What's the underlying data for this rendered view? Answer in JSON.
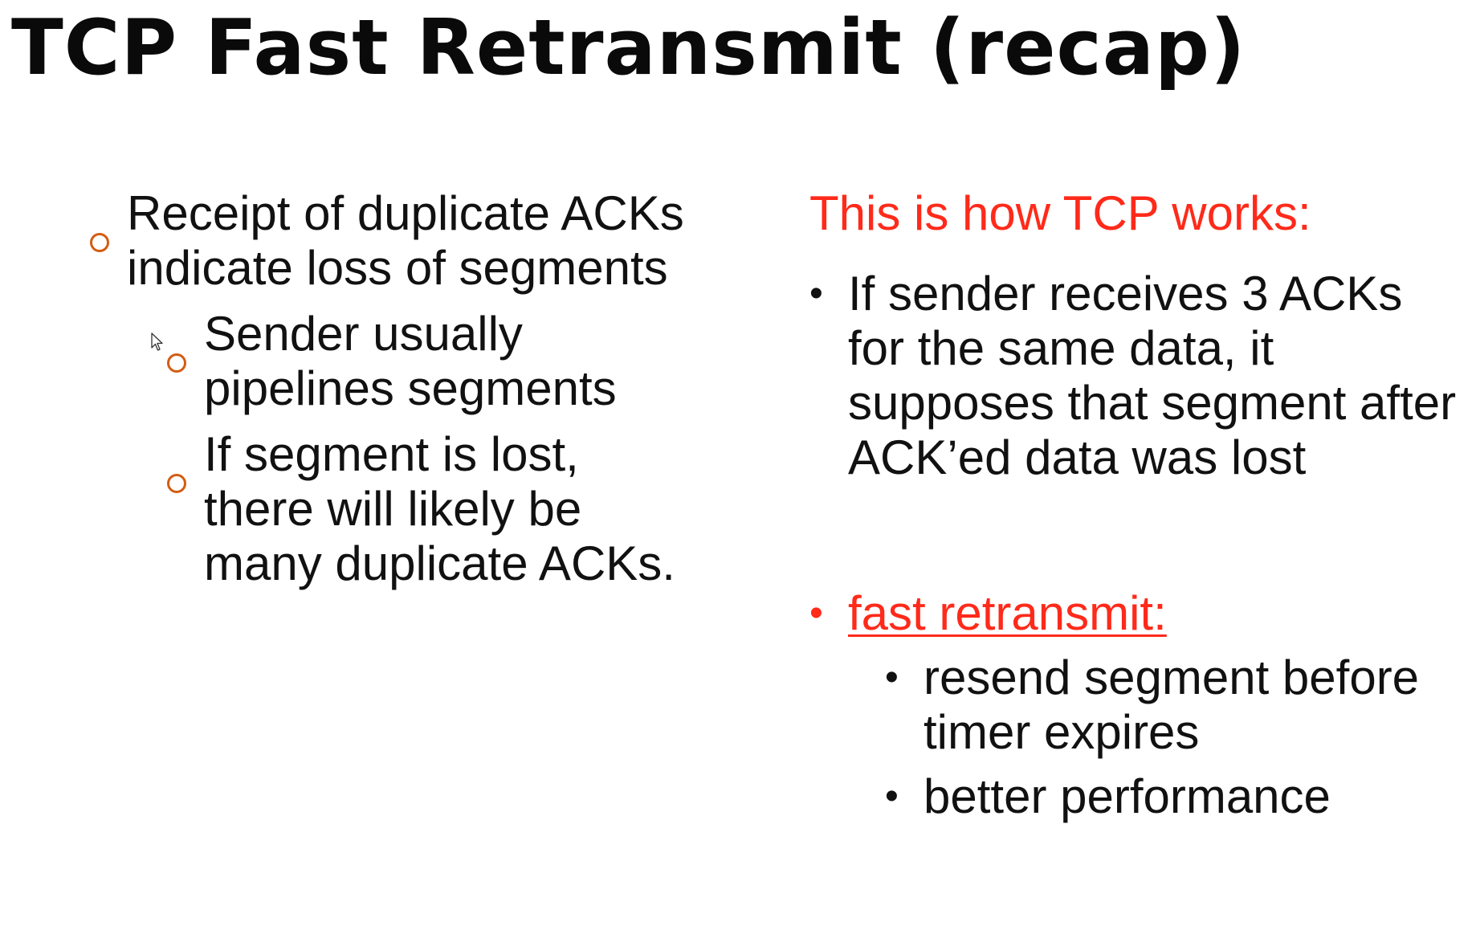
{
  "slide": {
    "title": "TCP Fast Retransmit (recap)"
  },
  "left": {
    "point": "Receipt of duplicate ACKs indicate loss of segments",
    "subpoints": [
      "Sender usually pipelines segments",
      "If segment is lost, there will likely be many duplicate ACKs."
    ]
  },
  "right": {
    "heading": "This is how TCP works:",
    "point": "If sender receives 3 ACKs for the same data, it supposes that segment after ACK’ed data was lost",
    "fast_retransmit_label": "fast retransmit:",
    "subpoints": [
      "resend segment before timer expires",
      "better performance"
    ]
  },
  "colors": {
    "accent_red": "#ff2a1a",
    "bullet_orange": "#d35c12",
    "text": "#111111"
  },
  "icons": {
    "left_bullet": "hollow-circle-icon",
    "right_bullet": "dot-icon",
    "pointer": "mouse-cursor-icon"
  }
}
